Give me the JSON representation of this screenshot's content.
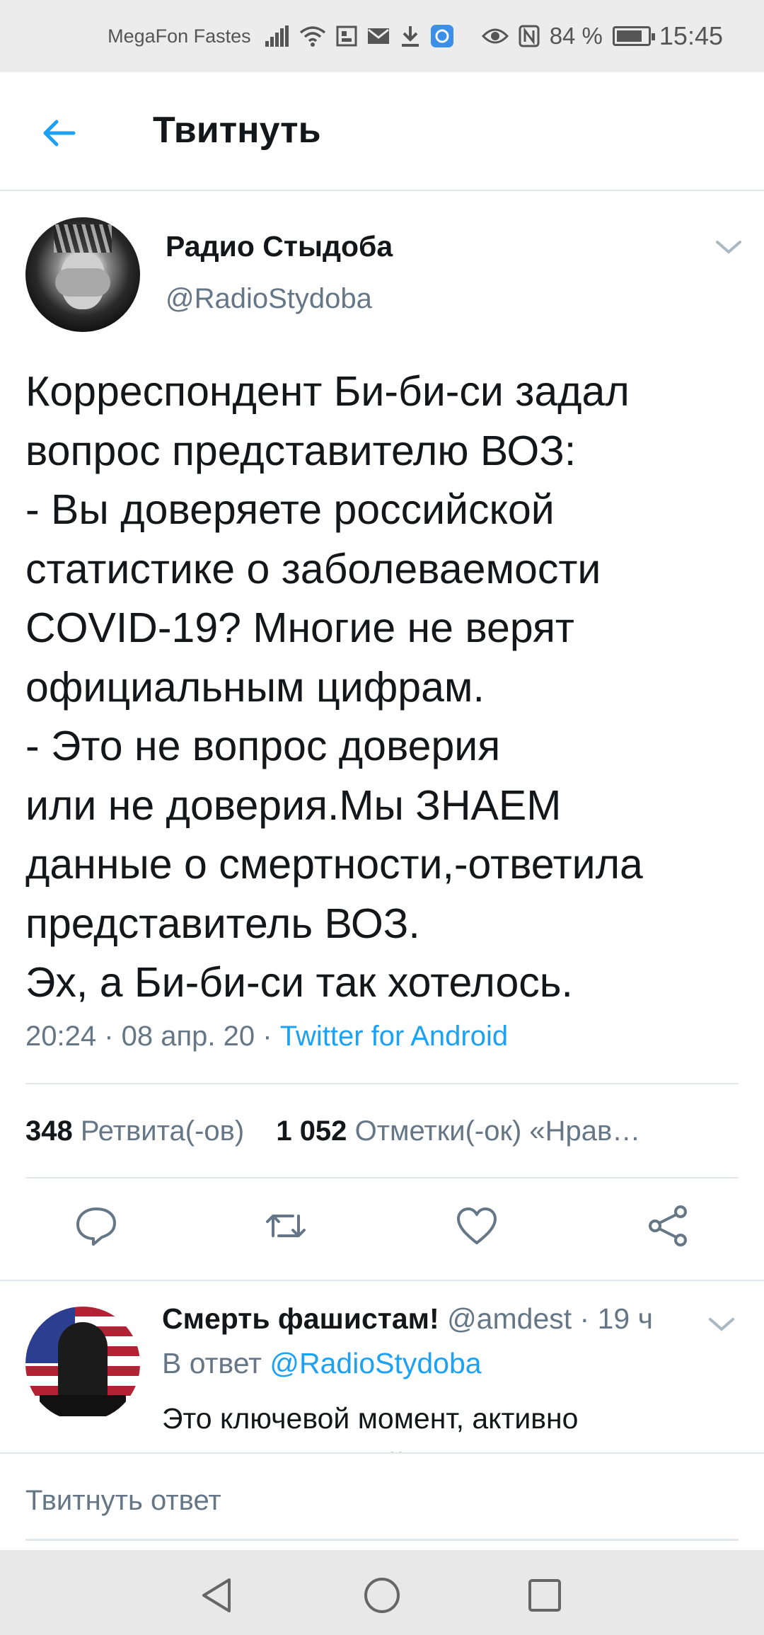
{
  "status_bar": {
    "carrier": "MegaFon Fastes",
    "battery_text": "84 %",
    "battery_level": 0.84,
    "time": "15:45"
  },
  "header": {
    "title": "Твитнуть"
  },
  "tweet": {
    "author_name": "Радио Стыдоба",
    "author_handle": "@RadioStydoba",
    "text": "Корреспондент Би-би-си задал\nвопрос представителю ВОЗ:\n- Вы доверяете российской\nстатистике о заболеваемости\nCOVID-19? Многие не верят\nофициальным цифрам.\n- Это не вопрос доверия\nили не доверия.Мы ЗНАЕМ\nданные о смертности,-ответила\nпредставитель ВОЗ.\nЭх, а Би-би-си так хотелось.",
    "time": "20:24",
    "date": "08 апр. 20",
    "source": "Twitter for Android",
    "retweets_count": "348",
    "retweets_label": "Ретвита(-ов)",
    "likes_count": "1 052",
    "likes_label": "Отметки(-ок) «Нрав…"
  },
  "reply": {
    "author_name": "Смерть фашистам!",
    "author_handle": "@amdest",
    "age": "19 ч",
    "reply_prefix": "В ответ",
    "reply_mention": "@RadioStydoba",
    "text": "Это ключевой момент, активно эксплуатирующийся на Западе, так"
  },
  "compose": {
    "placeholder": "Твитнуть ответ"
  },
  "colors": {
    "accent": "#1da1f2",
    "secondary_text": "#657786",
    "divider": "#e1e8ed"
  }
}
